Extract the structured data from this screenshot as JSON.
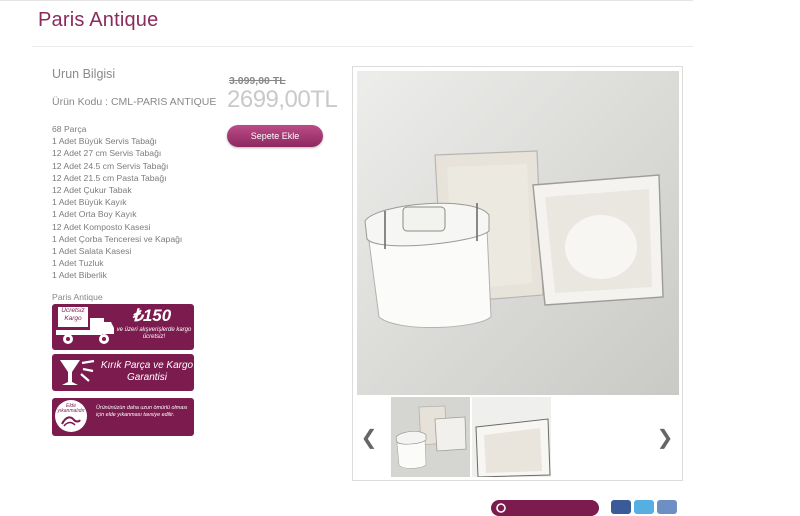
{
  "page": {
    "title": "Paris Antique"
  },
  "product": {
    "section_title": "Urun Bilgisi",
    "code": "Ürün Kodu : CML-PARIS ANTIQUE",
    "contents": [
      "68 Parça",
      "1 Adet Büyük Servis Tabağı",
      "12 Adet 27 cm Servis Tabağı",
      "12 Adet 24.5 cm Servis Tabağı",
      "12 Adet 21.5 cm Pasta Tabağı",
      "12 Adet Çukur Tabak",
      "1 Adet Büyük Kayık",
      "1 Adet Orta Boy Kayık",
      "12 Adet Komposto Kasesi",
      "1 Adet Çorba Tenceresi ve Kapağı",
      "1 Adet Salata Kasesi",
      "1 Adet Tuzluk",
      "1 Adet Biberlik"
    ],
    "brand_caption": "Paris Antique"
  },
  "price": {
    "old": "3.099,00 TL",
    "new": "2699,00TL",
    "add_to_cart": "Sepete Ekle"
  },
  "badges": {
    "cargo": {
      "strip_label": "Ücretsiz Kargo",
      "amount": "₺150",
      "note": "ve üzeri alışverişlerde kargo ücretsiz!"
    },
    "guarantee": {
      "text": "Kırık Parça ve Kargo Garantisi"
    },
    "handwash": {
      "icon_text": "Elde yıkanmalıdır",
      "text": "Ürününüzün daha uzun ömürlü olması için elde yıkanması tavsiye edilir."
    }
  },
  "gallery": {
    "prev_label": "❮",
    "next_label": "❯",
    "thumbnail_count": 2
  },
  "colors": {
    "brand": "#7b1b4e",
    "button": "#a8396f",
    "facebook": "#3b5b98",
    "twitter": "#57aee2"
  },
  "icons": [
    "truck-icon",
    "broken-glass-icon",
    "hand-wash-icon",
    "chevron-left-icon",
    "chevron-right-icon",
    "facebook-icon",
    "twitter-icon",
    "share-icon"
  ]
}
